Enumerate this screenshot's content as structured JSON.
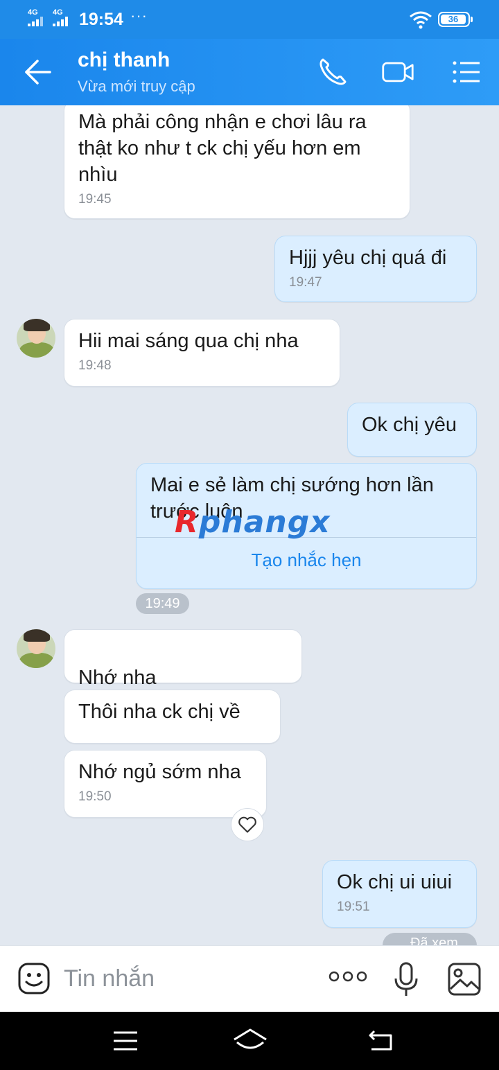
{
  "status_bar": {
    "net1": "4G",
    "net2": "4G",
    "time": "19:54",
    "more": "···",
    "battery": "36"
  },
  "header": {
    "title": "chị thanh",
    "subtitle": "Vừa mới truy cập"
  },
  "messages": [
    {
      "dir": "in",
      "text": "Mà phải công nhận e chơi lâu ra\nthật  ko như t ck chị yếu hơn em\nnhìu",
      "time": "19:45"
    },
    {
      "dir": "out",
      "text": "Hjjj yêu chị quá đi",
      "time": "19:47"
    },
    {
      "dir": "in",
      "text": "Hii mai sáng qua chị nha",
      "time": "19:48"
    },
    {
      "dir": "out",
      "text": "Ok chị yêu"
    },
    {
      "dir": "out",
      "text": "Mai e sẻ làm chị sướng hơn lần\ntrước luôn",
      "action": "Tạo nhắc hẹn"
    },
    {
      "dir": "in",
      "text": "Nhớ nha"
    },
    {
      "dir": "in",
      "text": "Thôi nha ck chị về"
    },
    {
      "dir": "in",
      "text": "Nhớ ngủ sớm nha",
      "time": "19:50"
    },
    {
      "dir": "out",
      "text": "Ok chị ui uiui",
      "time": "19:51"
    }
  ],
  "time_divider": "19:49",
  "seen_label": "Đã xem",
  "watermark": {
    "part1": "R",
    "part2": "phangx"
  },
  "composer": {
    "placeholder": "Tin nhắn"
  },
  "colors": {
    "header": "#1a86ec",
    "bubble_out": "#dbeeff",
    "background": "#e2e8f0",
    "link": "#1a86ec"
  }
}
